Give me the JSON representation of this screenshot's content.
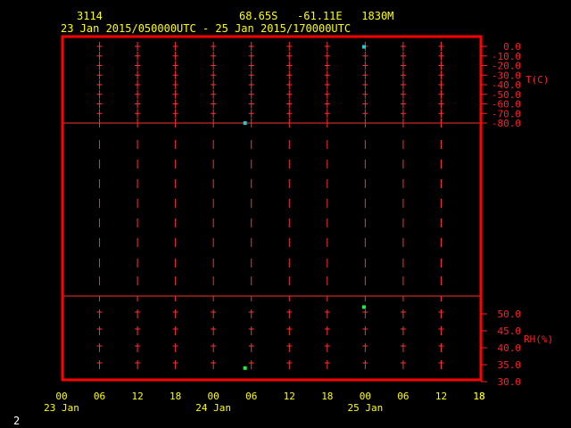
{
  "header": {
    "station_id": "3114",
    "location": "68.65S   -61.11E   1830M",
    "time_range": "23 Jan 2015/050000UTC - 25 Jan 2015/170000UTC"
  },
  "footer": {
    "page_number": "2"
  },
  "colors": {
    "frame": "#ff0000",
    "grid": "#ff3030",
    "axis_text": "#ffff00",
    "right_axis_text": "#ff2020",
    "temperature_marker": "#22cccc",
    "rh_marker": "#22ee44"
  },
  "chart_data": {
    "type": "scatter",
    "x_axis": {
      "tick_labels": [
        "00",
        "06",
        "12",
        "18",
        "00",
        "06",
        "12",
        "18",
        "00",
        "06",
        "12",
        "18"
      ],
      "date_labels": [
        {
          "label": "23 Jan",
          "at_hour": 0
        },
        {
          "label": "24 Jan",
          "at_hour": 24
        },
        {
          "label": "25 Jan",
          "at_hour": 48
        }
      ],
      "range_hours": [
        0,
        66
      ]
    },
    "panels": [
      {
        "name": "temperature",
        "ylabel": "T(C)",
        "ylim": [
          -80.0,
          0.0
        ],
        "ticks": [
          "0.0",
          "-10.0",
          "-20.0",
          "-30.0",
          "-40.0",
          "-50.0",
          "-60.0",
          "-70.0",
          "-80.0"
        ],
        "tick_values": [
          0,
          -10,
          -20,
          -30,
          -40,
          -50,
          -60,
          -70,
          -80
        ],
        "points": [
          {
            "x_hour": 47.8,
            "y": -0.5
          },
          {
            "x_hour": 29.0,
            "y": -80.0
          }
        ]
      },
      {
        "name": "wind_blank",
        "ylabel": "",
        "points": []
      },
      {
        "name": "relative_humidity",
        "ylabel": "RH(%)",
        "ylim": [
          30.0,
          50.0
        ],
        "ticks": [
          "50.0",
          "45.0",
          "40.0",
          "35.0",
          "30.0"
        ],
        "tick_values": [
          50,
          45,
          40,
          35,
          30
        ],
        "points": [
          {
            "x_hour": 47.8,
            "y": 52.0
          },
          {
            "x_hour": 29.0,
            "y": 34.0
          }
        ]
      }
    ],
    "grid": true
  }
}
